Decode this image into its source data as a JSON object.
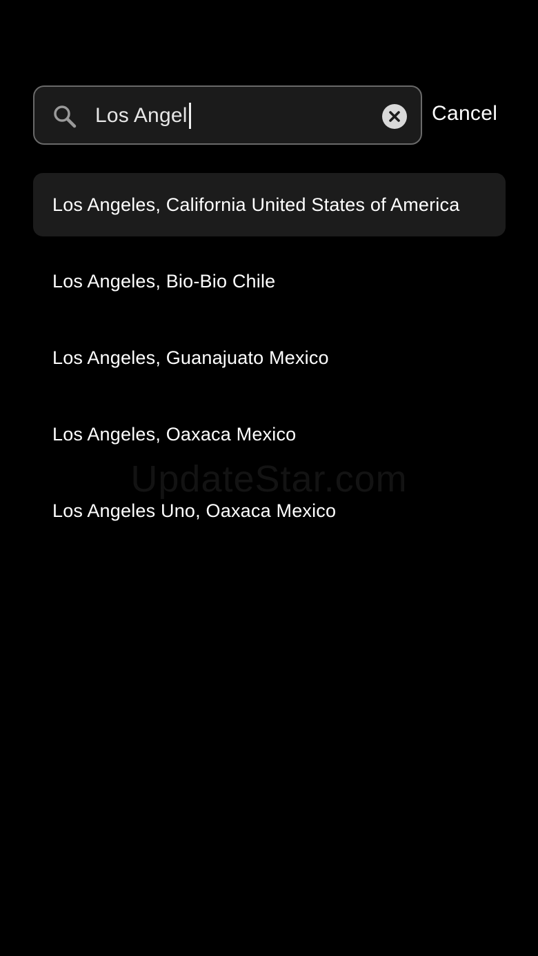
{
  "search": {
    "value": "Los Angel",
    "search_icon": "search-icon",
    "clear_icon": "clear-icon"
  },
  "cancel_label": "Cancel",
  "results": [
    {
      "label": "Los Angeles, California United States of America",
      "highlighted": true
    },
    {
      "label": "Los Angeles, Bio-Bio Chile",
      "highlighted": false
    },
    {
      "label": "Los Angeles, Guanajuato Mexico",
      "highlighted": false
    },
    {
      "label": "Los Angeles, Oaxaca Mexico",
      "highlighted": false
    },
    {
      "label": "Los Angeles Uno, Oaxaca Mexico",
      "highlighted": false
    }
  ],
  "watermark": "UpdateStar.com",
  "colors": {
    "background": "#000000",
    "field_background": "#1b1b1b",
    "field_border": "#6a6a6a",
    "highlight_row": "#1c1c1c",
    "text": "#ffffff"
  }
}
